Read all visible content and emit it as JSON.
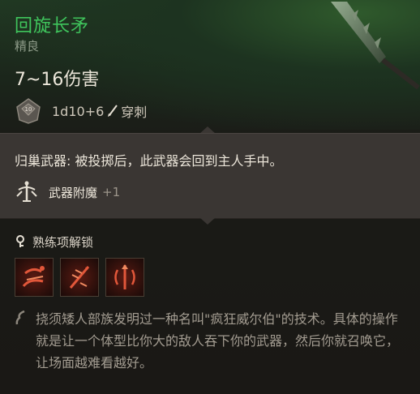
{
  "item": {
    "name": "回旋长矛",
    "rarity": "精良",
    "damage": "7~16伤害",
    "dice": "1d10+6",
    "damage_type": "穿刺",
    "description": "归巢武器: 被投掷后，此武器会回到主人手中。",
    "enchant_label": "武器附魔",
    "enchant_value": "+1",
    "proficiency_label": "熟练项解锁",
    "lore": "挠须矮人部族发明过一种名叫\"疯狂威尔伯\"的技术。具体的操作就是让一个体型比你大的敌人吞下你的武器，然后你就召唤它，让场面越难看越好。"
  },
  "skills": [
    "skill-1-icon",
    "skill-2-icon",
    "skill-3-icon"
  ],
  "colors": {
    "title": "#3fc45c",
    "desc_panel": "#3a3633",
    "skill_accent": "#e2573a"
  }
}
